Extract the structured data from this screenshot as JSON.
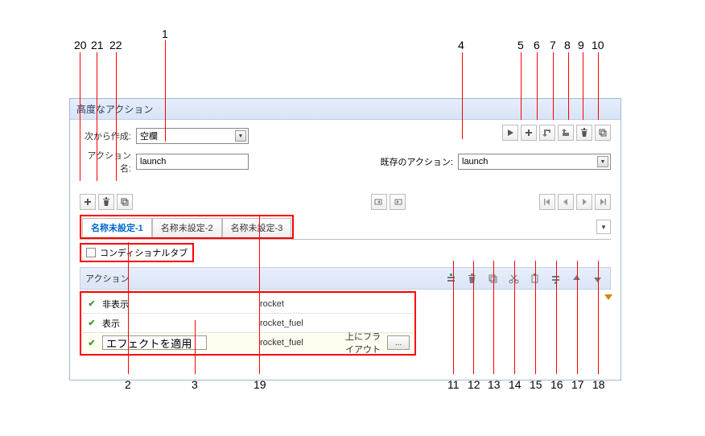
{
  "dialog": {
    "title": "高度なアクション",
    "create_from_label": "次から作成:",
    "create_from_value": "空欄",
    "action_name_label": "アクション名:",
    "action_name_value": "launch",
    "existing_action_label": "既存のアクション:",
    "existing_action_value": "launch"
  },
  "tabs": {
    "tab1": "名称未設定-1",
    "tab2": "名称未設定-2",
    "tab3": "名称未設定-3"
  },
  "conditional_tab_label": "コンディショナルタブ",
  "subheader_label": "アクション",
  "actions": [
    {
      "enabled": true,
      "name": "非表示",
      "target": "rocket",
      "param": ""
    },
    {
      "enabled": true,
      "name": "表示",
      "target": "rocket_fuel",
      "param": ""
    },
    {
      "enabled": true,
      "name": "エフェクトを適用",
      "target": "rocket_fuel",
      "param": "上にフライアウト"
    }
  ],
  "ellipsis": "...",
  "callouts": {
    "1": "1",
    "2": "2",
    "3": "3",
    "4": "4",
    "5": "5",
    "6": "6",
    "7": "7",
    "8": "8",
    "9": "9",
    "10": "10",
    "11": "11",
    "12": "12",
    "13": "13",
    "14": "14",
    "15": "15",
    "16": "16",
    "17": "17",
    "18": "18",
    "19": "19",
    "20": "20",
    "21": "21",
    "22": "22"
  }
}
